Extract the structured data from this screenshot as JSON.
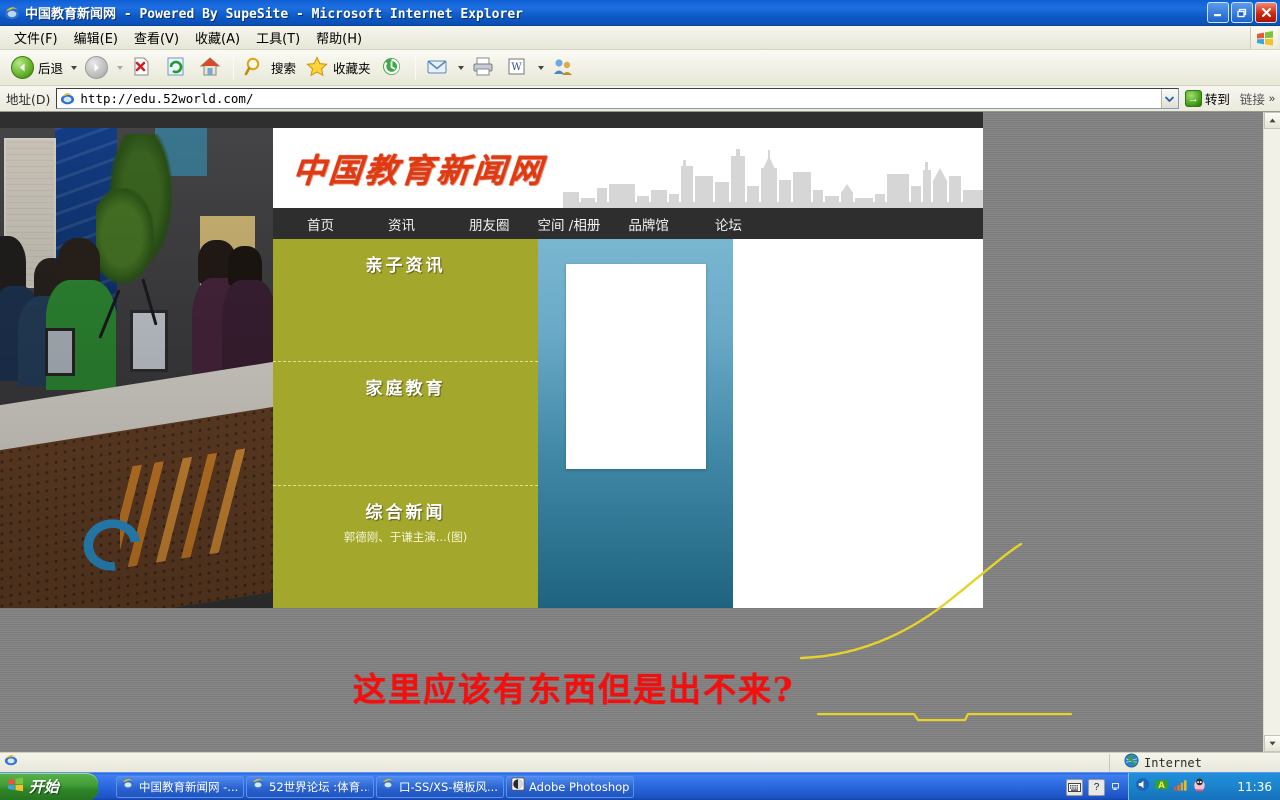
{
  "window": {
    "title": "中国教育新闻网 - Powered By SupeSite - Microsoft Internet Explorer",
    "minimize_label": "_",
    "maximize_label": "❐",
    "close_label": "✕"
  },
  "menubar": {
    "items": [
      {
        "label": "文件(F)",
        "name": "menu-file"
      },
      {
        "label": "编辑(E)",
        "name": "menu-edit"
      },
      {
        "label": "查看(V)",
        "name": "menu-view"
      },
      {
        "label": "收藏(A)",
        "name": "menu-favorites"
      },
      {
        "label": "工具(T)",
        "name": "menu-tools"
      },
      {
        "label": "帮助(H)",
        "name": "menu-help"
      }
    ]
  },
  "toolbar": {
    "back_label": "后退",
    "search_label": "搜索",
    "favorites_label": "收藏夹",
    "icons": {
      "back": "back-arrow-icon",
      "forward": "forward-arrow-icon",
      "stop": "stop-icon",
      "refresh": "refresh-icon",
      "home": "home-icon",
      "search": "magnifier-icon",
      "favorites": "star-icon",
      "history": "history-icon",
      "mail": "mail-icon",
      "print": "printer-icon",
      "edit": "word-edit-icon",
      "messenger": "messenger-icon"
    }
  },
  "addressbar": {
    "label": "地址(D)",
    "url": "http://edu.52world.com/",
    "placeholder": "http://",
    "go_label": "转到",
    "links_label": "链接",
    "overflow_label": "»"
  },
  "page": {
    "logo_text": "中国教育新闻网",
    "nav": [
      {
        "label": "首页",
        "name": "nav-home"
      },
      {
        "label": "资讯",
        "name": "nav-news"
      },
      {
        "label": "朋友圈",
        "name": "nav-friends"
      },
      {
        "label": "空间 /相册",
        "name": "nav-space-album"
      },
      {
        "label": "品牌馆",
        "name": "nav-brand"
      },
      {
        "label": "论坛",
        "name": "nav-forum"
      }
    ],
    "green_sections": [
      {
        "title": "亲子资讯",
        "subtitle": ""
      },
      {
        "title": "家庭教育",
        "subtitle": ""
      },
      {
        "title": "综合新闻",
        "subtitle": "郭德刚、于谦主演...(图)"
      }
    ],
    "photo_alt": "广播电台演播室照片"
  },
  "annotation": {
    "text": "这里应该有东西但是出不来?",
    "color": "#f01010",
    "marker_color": "#e6d32a"
  },
  "statusbar": {
    "zone": "Internet"
  },
  "taskbar": {
    "start_label": "开始",
    "tasks": [
      {
        "label": "中国教育新闻网 -...",
        "name": "task-ie-jyxww"
      },
      {
        "label": "52世界论坛 :体育...",
        "name": "task-ie-52world"
      },
      {
        "label": "口-SS/XS-模板风...",
        "name": "task-ie-template"
      },
      {
        "label": "Adobe Photoshop",
        "name": "task-photoshop"
      }
    ],
    "clock": "11:36",
    "tray_icons": [
      "keyboard-icon",
      "help-icon",
      "restore-icon",
      "volume-icon",
      "language-a-icon",
      "signal-icon",
      "qq-icon"
    ]
  },
  "colors": {
    "accent_blue": "#1c6fe0",
    "olive": "#a3a72c",
    "teal": "#3f87a5",
    "logo_red": "#e03a12"
  }
}
